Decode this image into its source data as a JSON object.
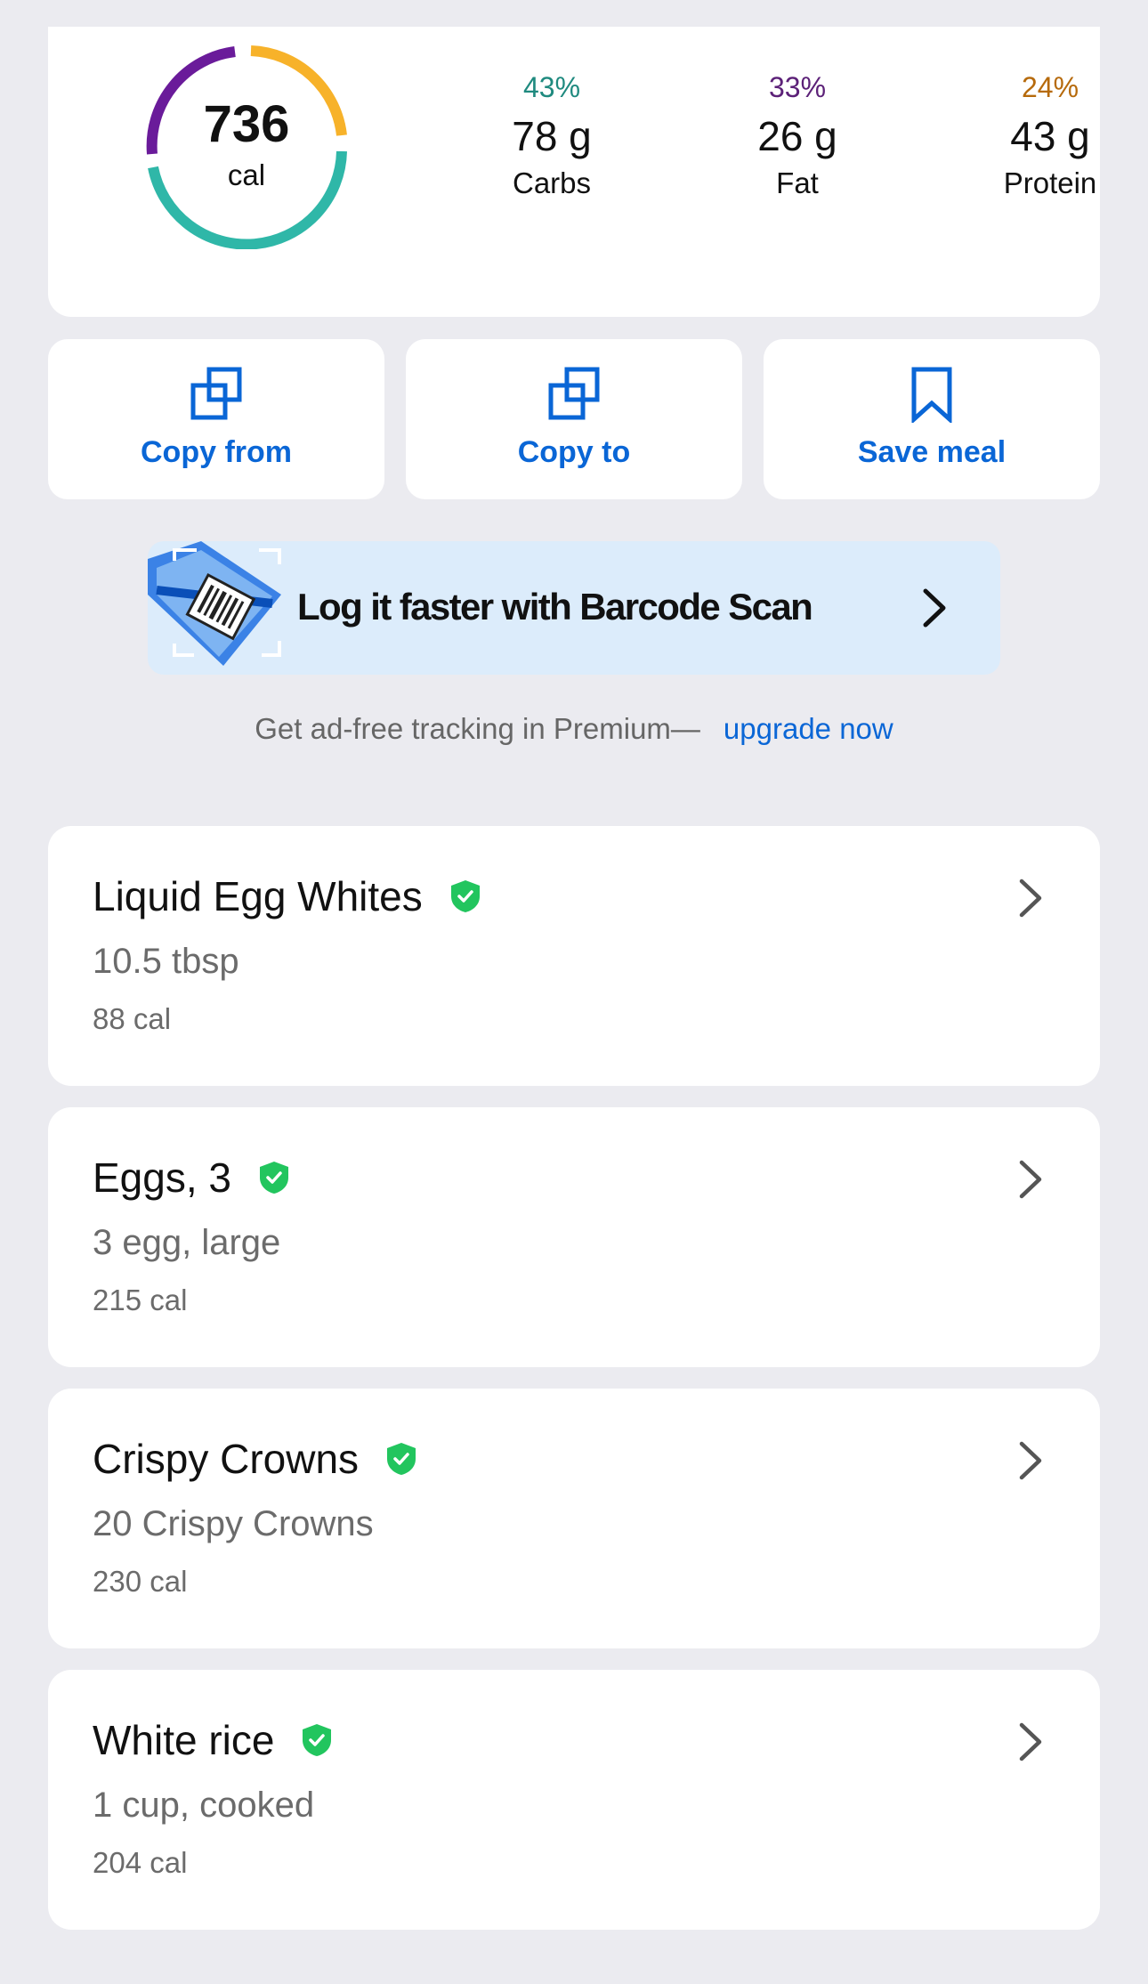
{
  "summary": {
    "calories_value": "736",
    "calories_unit": "cal",
    "ring_colors": {
      "carbs": "#2fb7a8",
      "fat": "#6a1b9a",
      "protein": "#f7b22a"
    },
    "macros": [
      {
        "pct": "43%",
        "grams": "78 g",
        "label": "Carbs"
      },
      {
        "pct": "33%",
        "grams": "26 g",
        "label": "Fat"
      },
      {
        "pct": "24%",
        "grams": "43 g",
        "label": "Protein"
      }
    ]
  },
  "actions": {
    "copy_from": {
      "label": "Copy from",
      "icon": "copy-icon"
    },
    "copy_to": {
      "label": "Copy to",
      "icon": "copy-icon"
    },
    "save_meal": {
      "label": "Save meal",
      "icon": "bookmark-icon"
    }
  },
  "banner": {
    "text": "Log it faster with Barcode Scan",
    "icon": "barcode-scan-icon"
  },
  "premium": {
    "text": "Get ad-free tracking in Premium—",
    "link": "upgrade now"
  },
  "foods": [
    {
      "name": "Liquid Egg Whites",
      "serving": "10.5 tbsp",
      "calories": "88 cal"
    },
    {
      "name": "Eggs, 3",
      "serving": "3 egg, large",
      "calories": "215 cal"
    },
    {
      "name": "Crispy Crowns",
      "serving": "20 Crispy Crowns",
      "calories": "230 cal"
    },
    {
      "name": "White rice",
      "serving": "1 cup, cooked",
      "calories": "204 cal"
    }
  ],
  "colors": {
    "accent": "#0a66d6",
    "verified": "#22c55e",
    "background": "#ebebf0"
  }
}
